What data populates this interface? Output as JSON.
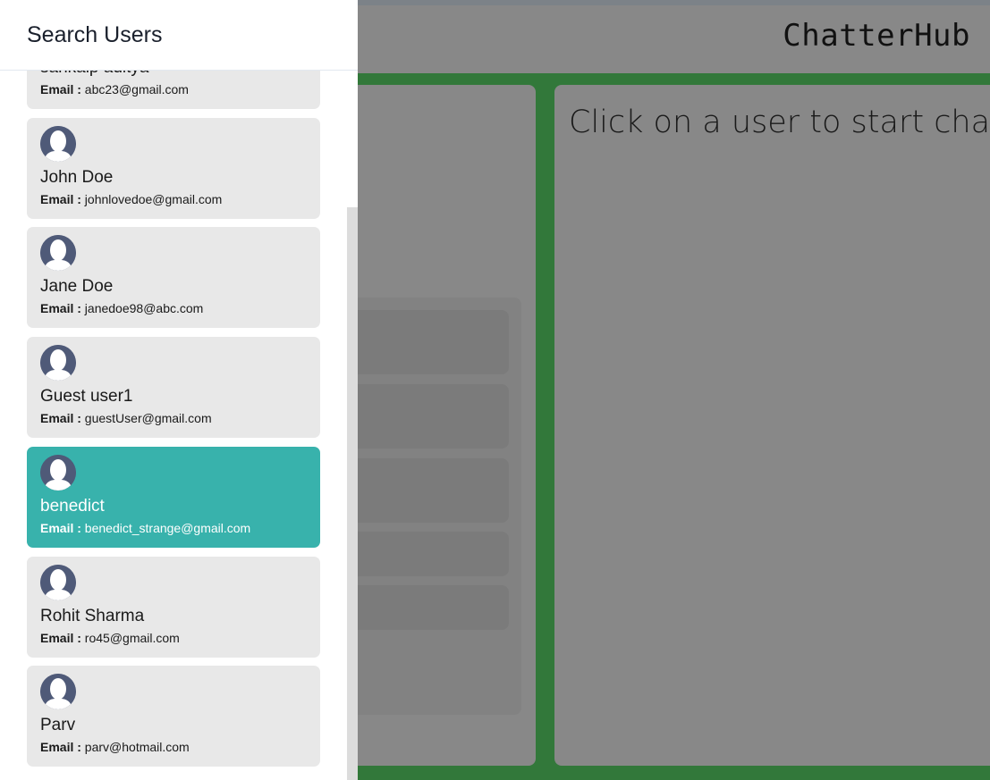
{
  "app": {
    "brand": "ChatterHub"
  },
  "chat": {
    "placeholder": "Click on a user to start chatting"
  },
  "drawer": {
    "title": "Search Users",
    "email_label": "Email :",
    "users": [
      {
        "name": "sankalp aditya",
        "email": "abc23@gmail.com",
        "selected": false
      },
      {
        "name": "John Doe",
        "email": "johnlovedoe@gmail.com",
        "selected": false
      },
      {
        "name": "Jane Doe",
        "email": "janedoe98@abc.com",
        "selected": false
      },
      {
        "name": "Guest user1",
        "email": "guestUser@gmail.com",
        "selected": false
      },
      {
        "name": "benedict",
        "email": "benedict_strange@gmail.com",
        "selected": true
      },
      {
        "name": "Rohit Sharma",
        "email": "ro45@gmail.com",
        "selected": false
      },
      {
        "name": "Parv",
        "email": "parv@hotmail.com",
        "selected": false
      }
    ]
  },
  "colors": {
    "selected_card": "#38b2ac",
    "card": "#e8e8e8",
    "avatar": "#4f5a78",
    "app_accent_green": "#32783a"
  },
  "icons": {
    "avatar": "user-avatar-icon"
  }
}
